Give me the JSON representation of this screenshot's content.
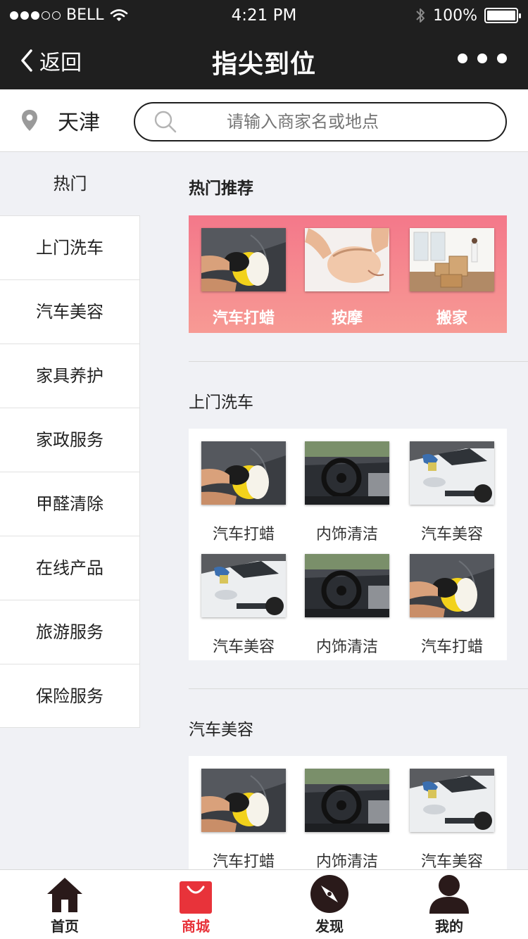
{
  "status_bar": {
    "carrier": "BELL",
    "time": "4:21 PM",
    "battery": "100%"
  },
  "nav": {
    "back_label": "返回",
    "title": "指尖到位"
  },
  "location": {
    "city": "天津"
  },
  "search": {
    "placeholder": "请输入商家名或地点"
  },
  "sidebar": {
    "hot_label": "热门",
    "items": [
      {
        "label": "上门洗车"
      },
      {
        "label": "汽车美容"
      },
      {
        "label": "家具养护"
      },
      {
        "label": "家政服务"
      },
      {
        "label": "甲醛清除"
      },
      {
        "label": "在线产品"
      },
      {
        "label": "旅游服务"
      },
      {
        "label": "保险服务"
      }
    ]
  },
  "sections": {
    "hot": {
      "title": "热门推荐",
      "items": [
        {
          "label": "汽车打蜡",
          "image": "car-polisher"
        },
        {
          "label": "按摩",
          "image": "massage"
        },
        {
          "label": "搬家",
          "image": "moving-boxes"
        }
      ]
    },
    "wash": {
      "title": "上门洗车",
      "items": [
        {
          "label": "汽车打蜡",
          "image": "car-polisher"
        },
        {
          "label": "内饰清洁",
          "image": "car-interior"
        },
        {
          "label": "汽车美容",
          "image": "white-car"
        },
        {
          "label": "汽车美容",
          "image": "white-car"
        },
        {
          "label": "内饰清洁",
          "image": "car-interior"
        },
        {
          "label": "汽车打蜡",
          "image": "car-polisher"
        }
      ]
    },
    "beauty": {
      "title": "汽车美容",
      "items": [
        {
          "label": "汽车打蜡",
          "image": "car-polisher"
        },
        {
          "label": "内饰清洁",
          "image": "car-interior"
        },
        {
          "label": "汽车美容",
          "image": "white-car"
        }
      ]
    }
  },
  "tabbar": {
    "items": [
      {
        "label": "首页",
        "icon": "home-icon"
      },
      {
        "label": "商城",
        "icon": "shopping-bag-icon"
      },
      {
        "label": "发现",
        "icon": "compass-icon"
      },
      {
        "label": "我的",
        "icon": "user-icon"
      }
    ],
    "active_color": "#e8333a"
  },
  "colors": {
    "nav_bg": "#1f1f1f",
    "banner": "#f4788a",
    "page_bg": "#f0f1f5"
  }
}
